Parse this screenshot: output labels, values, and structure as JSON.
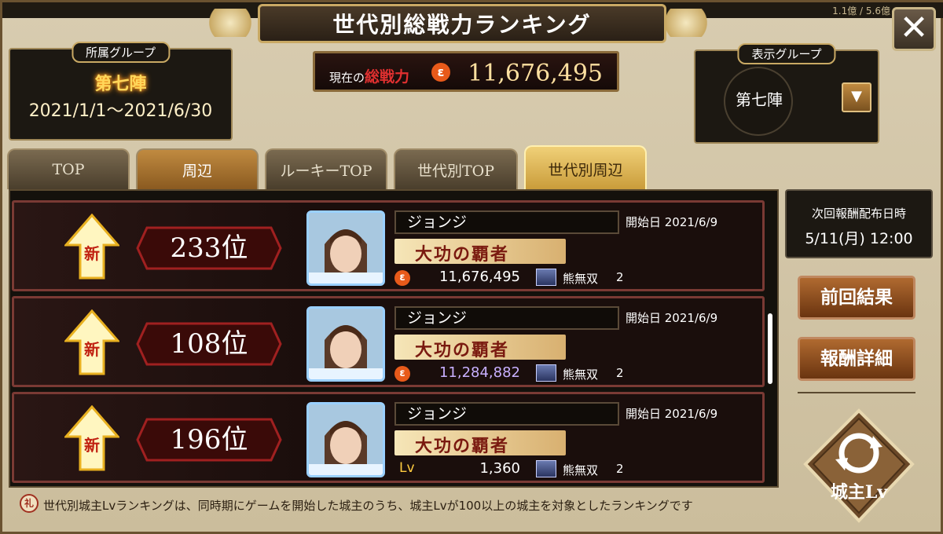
{
  "header": {
    "title": "世代別総戦力ランキング",
    "close_label": "✕",
    "top_meta": "1.1億 / 5.6億"
  },
  "affiliation": {
    "label": "所属グループ",
    "group": "第七陣",
    "period": "2021/1/1〜2021/6/30"
  },
  "power": {
    "label_prefix": "現在の",
    "label_main": "総戦力",
    "icon": "battle-power-icon",
    "value": "11,676,495"
  },
  "display_group": {
    "label": "表示グループ",
    "value": "第七陣",
    "dropdown_icon": "▼"
  },
  "tabs": [
    {
      "label": "TOP",
      "state": "inactive"
    },
    {
      "label": "周辺",
      "state": "orange"
    },
    {
      "label": "ルーキーTOP",
      "state": "inactive"
    },
    {
      "label": "世代別TOP",
      "state": "inactive"
    },
    {
      "label": "世代別周辺",
      "state": "active"
    }
  ],
  "rows": [
    {
      "rank": "233位",
      "new_label": "新",
      "name": "ジョンジ",
      "start_date": "開始日 2021/6/9",
      "title": "大功の覇者",
      "stat_type": "power",
      "stat_value": "11,676,495",
      "stat_color": "#ffffff",
      "card_name": "熊無双",
      "card_count": "2"
    },
    {
      "rank": "108位",
      "new_label": "新",
      "name": "ジョンジ",
      "start_date": "開始日 2021/6/9",
      "title": "大功の覇者",
      "stat_type": "power",
      "stat_value": "11,284,882",
      "stat_color": "#c8b0ff",
      "card_name": "熊無双",
      "card_count": "2"
    },
    {
      "rank": "196位",
      "new_label": "新",
      "name": "ジョンジ",
      "start_date": "開始日 2021/6/9",
      "title": "大功の覇者",
      "stat_type": "lv",
      "stat_label": "Lv",
      "stat_value": "1,360",
      "stat_color": "#ffffff",
      "card_name": "熊無双",
      "card_count": "2"
    }
  ],
  "reward": {
    "label": "次回報酬配布日時",
    "datetime": "5/11(月) 12:00"
  },
  "buttons": {
    "previous_results": "前回結果",
    "reward_details": "報酬詳細",
    "lv_toggle": "城主Lv"
  },
  "footer": {
    "icon": "礼",
    "text": "世代別城主Lvランキングは、同時期にゲームを開始した城主のうち、城主Lvが100以上の城主を対象としたランキングです"
  },
  "colors": {
    "accent_gold": "#c9a964",
    "row_border": "#7a3a34",
    "button_brown": "#b06a30"
  }
}
